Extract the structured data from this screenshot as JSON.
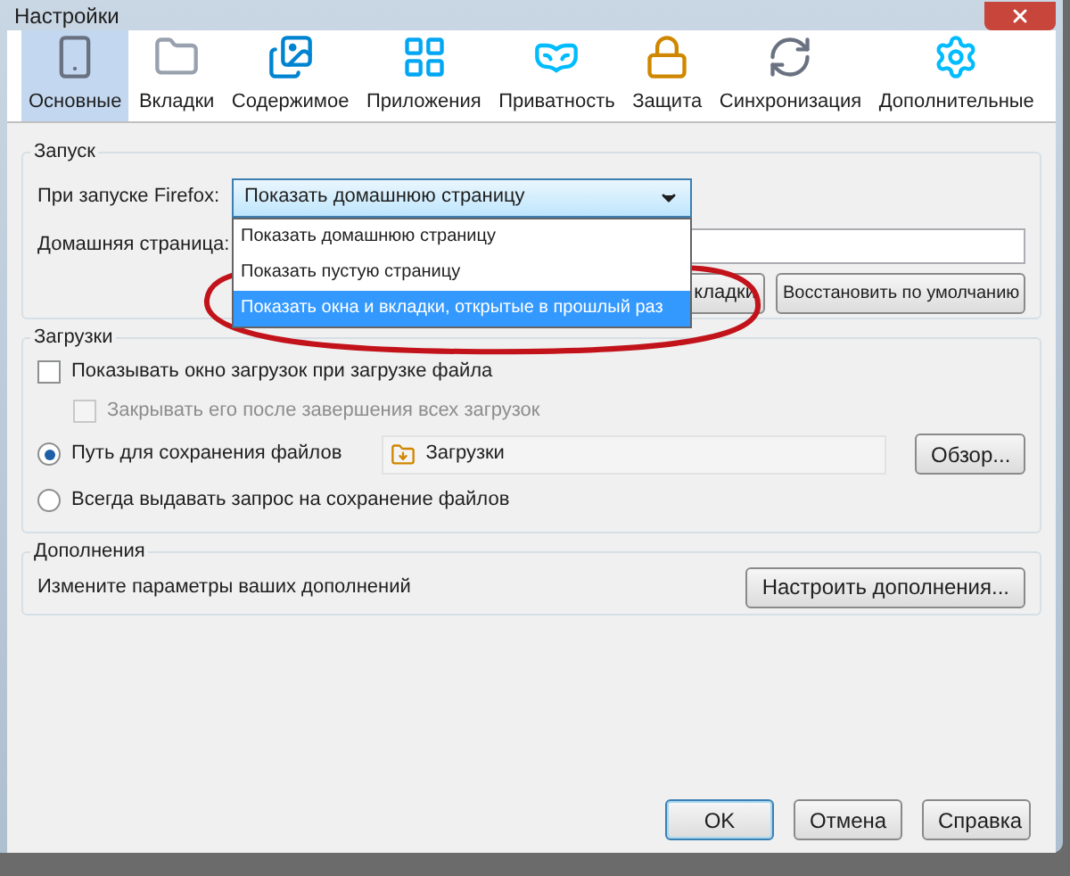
{
  "window": {
    "title": "Настройки"
  },
  "tabs": [
    {
      "label": "Основные",
      "selected": true
    },
    {
      "label": "Вкладки",
      "selected": false
    },
    {
      "label": "Содержимое",
      "selected": false
    },
    {
      "label": "Приложения",
      "selected": false
    },
    {
      "label": "Приватность",
      "selected": false
    },
    {
      "label": "Защита",
      "selected": false
    },
    {
      "label": "Синхронизация",
      "selected": false
    },
    {
      "label": "Дополнительные",
      "selected": false
    }
  ],
  "startup": {
    "title": "Запуск",
    "label": "При запуске Firefox:",
    "value": "Показать домашнюю страницу",
    "options": [
      {
        "label": "Показать домашнюю страницу",
        "highlighted": false
      },
      {
        "label": "Показать пустую страницу",
        "highlighted": false
      },
      {
        "label": "Показать окна и вкладки, открытые в прошлый раз",
        "highlighted": true
      }
    ],
    "home_label": "Домашняя страница:",
    "covered_button": "кладки",
    "restore_button": "Восстановить по умолчанию"
  },
  "downloads": {
    "title": "Загрузки",
    "options": [
      {
        "kind": "checkbox",
        "label": "Показывать окно загрузок при загрузке файла",
        "checked": false,
        "disabled": false
      },
      {
        "kind": "checkbox",
        "label": "Закрывать его после завершения всех загрузок",
        "checked": false,
        "disabled": true
      },
      {
        "kind": "radio",
        "label": "Путь для сохранения файлов",
        "selected": true,
        "folder": "Загрузки",
        "button": "Обзор..."
      },
      {
        "kind": "radio",
        "label": "Всегда выдавать запрос на сохранение файлов",
        "selected": false
      }
    ]
  },
  "addons": {
    "title": "Дополнения",
    "text": "Измените параметры ваших дополнений",
    "button": "Настроить дополнения..."
  },
  "buttons": [
    {
      "label": "OK",
      "default": true
    },
    {
      "label": "Отмена",
      "default": false
    },
    {
      "label": "Справка",
      "default": false
    }
  ]
}
